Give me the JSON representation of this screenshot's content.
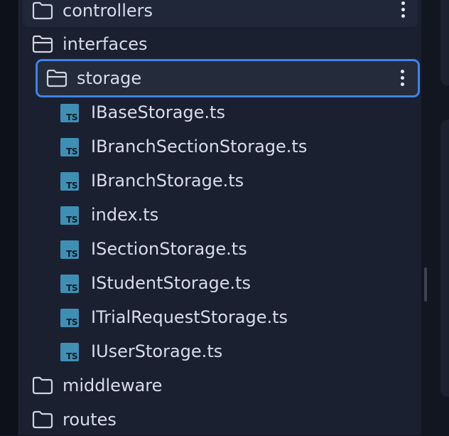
{
  "tree": {
    "folders": {
      "controllers": "controllers",
      "interfaces": "interfaces",
      "storage": "storage",
      "middleware": "middleware",
      "routes": "routes"
    },
    "files": [
      "IBaseStorage.ts",
      "IBranchSectionStorage.ts",
      "IBranchStorage.ts",
      "index.ts",
      "ISectionStorage.ts",
      "IStudentStorage.ts",
      "ITrialRequestStorage.ts",
      "IUserStorage.ts"
    ],
    "ts_badge": "TS"
  },
  "icons": {
    "folder": "folder-icon",
    "folder_open": "folder-open-icon",
    "file": "typescript-file-icon",
    "more": "more-vertical-icon"
  },
  "colors": {
    "background": "#1a2030",
    "text": "#d7dce8",
    "selection_border": "#3f83e6",
    "ts_icon": "#3f8fb5"
  }
}
